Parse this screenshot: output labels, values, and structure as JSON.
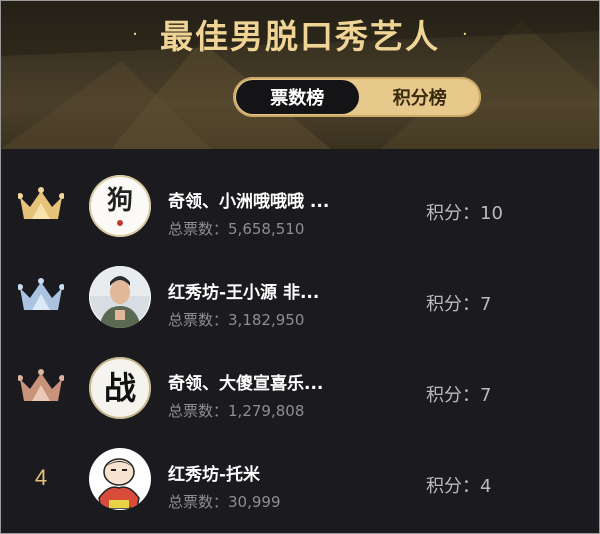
{
  "header": {
    "title": "最佳男脱口秀艺人",
    "dot": "·"
  },
  "tabs": [
    {
      "label": "票数榜",
      "active": true
    },
    {
      "label": "积分榜",
      "active": false
    }
  ],
  "labels": {
    "votes_prefix": "总票数：",
    "score_prefix": "积分："
  },
  "rankings": [
    {
      "rank": "1",
      "badge": "gold-crown-icon",
      "name": "奇领、小洲哦哦哦 ...",
      "votes": "5,658,510",
      "score": "10",
      "avatar": "calligraphy-gou-avatar"
    },
    {
      "rank": "2",
      "badge": "silver-crown-icon",
      "name": "红秀坊-王小源 非...",
      "votes": "3,182,950",
      "score": "7",
      "avatar": "man-photo-avatar"
    },
    {
      "rank": "3",
      "badge": "bronze-crown-icon",
      "name": "奇领、大傻宣喜乐...",
      "votes": "1,279,808",
      "score": "7",
      "avatar": "calligraphy-zhan-avatar"
    },
    {
      "rank": "4",
      "badge": "",
      "name": "红秀坊-托米",
      "votes": "30,999",
      "score": "4",
      "avatar": "cartoon-boy-avatar"
    }
  ],
  "avatar_text": {
    "gou": "狗",
    "zhan": "战"
  },
  "colors": {
    "gold": "#e6c27a",
    "silver": "#a9c3e0",
    "bronze": "#c8937a"
  }
}
